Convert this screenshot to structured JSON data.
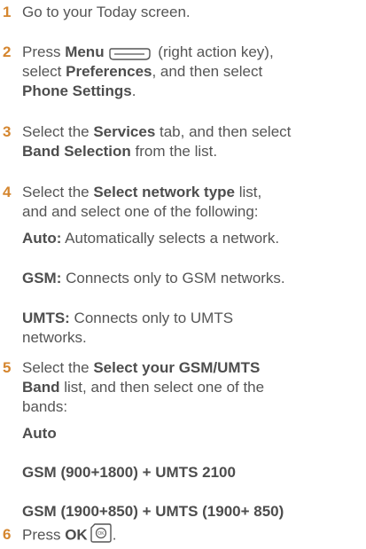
{
  "steps": [
    {
      "number": "1",
      "text": "Go to your Today screen."
    },
    {
      "number": "2",
      "press": "Press ",
      "menu": "Menu",
      "menu_note": " (right action key),",
      "select1": "select ",
      "preferences": "Preferences",
      "then_select": ", and then select",
      "phone_settings": "Phone Settings",
      "end": "."
    },
    {
      "number": "3",
      "select": "Select the ",
      "services": "Services",
      "tab_then": " tab, and then select",
      "band_selection": "Band Selection",
      "from_list": " from the list."
    },
    {
      "number": "4",
      "select": "Select the ",
      "network_type": "Select network type",
      "list": " list,",
      "line2": "and and select one of the following:",
      "options": [
        {
          "label": "Auto:",
          "desc": " Automatically selects a network."
        },
        {
          "label": "GSM:",
          "desc": " Connects only to GSM networks."
        },
        {
          "label": "UMTS:",
          "desc": " Connects only to UMTS",
          "desc2": "networks."
        }
      ]
    },
    {
      "number": "5",
      "select": "Select the ",
      "gsm_umts": "Select your GSM/UMTS",
      "band": "Band",
      "list_then": " list, and then select one of the",
      "bands_label": "bands:",
      "bands": [
        "Auto",
        "GSM (900+1800) + UMTS 2100",
        "GSM (1900+850) + UMTS (1900+ 850)"
      ]
    },
    {
      "number": "6",
      "press": "Press ",
      "ok": "OK",
      "end": "."
    }
  ],
  "icons": {
    "menu_key": "right-action-key-icon",
    "ok_button": "ok-button-icon"
  },
  "colors": {
    "step_number": "#d5862f",
    "text": "#555555"
  }
}
